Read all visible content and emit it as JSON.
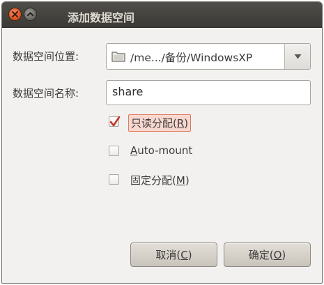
{
  "window": {
    "title": "添加数据空间"
  },
  "form": {
    "location_label": "数据空间位置:",
    "location_value": "/me.../备份/WindowsXP",
    "name_label": "数据空间名称:",
    "name_value": "share"
  },
  "options": {
    "readonly": {
      "label_pre": "只读分配(",
      "mnemonic": "R",
      "label_post": ")",
      "checked": true
    },
    "automount": {
      "mnemonic": "A",
      "label_rest": "uto-mount",
      "checked": false
    },
    "fixed": {
      "label_pre": "固定分配(",
      "mnemonic": "M",
      "label_post": ")",
      "checked": false
    }
  },
  "buttons": {
    "cancel": {
      "label_pre": "取消(",
      "mnemonic": "C",
      "label_post": ")"
    },
    "ok": {
      "label_pre": "确定(",
      "mnemonic": "O",
      "label_post": ")"
    }
  },
  "colors": {
    "titlebar": "#3c3b37",
    "close_button": "#e2541e",
    "focus_highlight": "#f8d7cf",
    "check_mark": "#c0392b",
    "dialog_bg": "#f2f1ef"
  },
  "icons": {
    "close": "close-icon",
    "minimize": "minimize-icon",
    "folder": "folder-icon",
    "dropdown": "chevron-down-icon",
    "check": "checkmark-icon"
  }
}
